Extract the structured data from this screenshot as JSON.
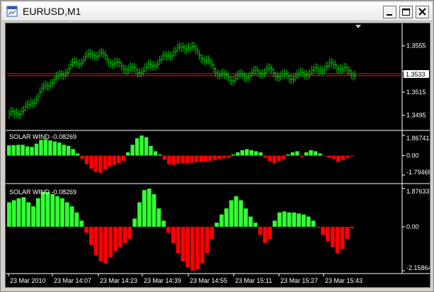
{
  "window": {
    "title": "EURUSD,M1",
    "controls": {
      "minimize": "minimize",
      "maximize": "maximize",
      "close": "close"
    }
  },
  "colors": {
    "background": "#000000",
    "bars": "#00c800",
    "positive": "#33ff33",
    "negative": "#ff0000",
    "axis_text": "#ffffff",
    "price_line": "#d02020"
  },
  "price_chart": {
    "type": "ohlc-bars",
    "y_ticks": [
      "1.3555",
      "1.3533",
      "1.3515",
      "1.3495"
    ],
    "tick_values": [
      1.3555,
      1.3533,
      1.3515,
      1.3495
    ],
    "current_price_label": "1.3533",
    "ylim": [
      1.3485,
      1.3572
    ],
    "closes": [
      1.3496,
      1.3499,
      1.3503,
      1.351,
      1.3518,
      1.3524,
      1.3527,
      1.3533,
      1.3538,
      1.3542,
      1.3545,
      1.3549,
      1.3547,
      1.3543,
      1.3539,
      1.3537,
      1.3535,
      1.3533,
      1.3535,
      1.3538,
      1.3542,
      1.3546,
      1.355,
      1.3553,
      1.3555,
      1.3551,
      1.3545,
      1.3539,
      1.3533,
      1.3528,
      1.3527,
      1.3528,
      1.353,
      1.3531,
      1.3533,
      1.3534,
      1.3531,
      1.3529,
      1.3528,
      1.3529,
      1.3531,
      1.3533,
      1.3534,
      1.3537,
      1.3539,
      1.3536,
      1.3533,
      1.3531
    ]
  },
  "indicators": [
    {
      "name": "SOLAR WIND",
      "label": "SOLAR WIND -0.08269",
      "y_labels": [
        "1.86741",
        "0.00",
        "-1.79468"
      ],
      "ylim": [
        -1.79468,
        1.86741
      ],
      "values": [
        0.95,
        0.97,
        0.99,
        1.0,
        0.85,
        0.8,
        1.1,
        1.45,
        1.5,
        1.4,
        1.3,
        1.2,
        1.0,
        0.9,
        0.6,
        0.2,
        -0.3,
        -0.8,
        -1.2,
        -1.5,
        -1.6,
        -1.3,
        -1.0,
        -0.85,
        -0.7,
        -0.5,
        0.3,
        1.0,
        1.6,
        1.85,
        1.7,
        0.9,
        0.4,
        0.1,
        -0.4,
        -0.8,
        -0.85,
        -0.75,
        -0.7,
        -0.7,
        -0.65,
        -0.6,
        -0.6,
        -0.55,
        -0.5,
        -0.4,
        -0.3,
        -0.25,
        -0.2,
        0.1,
        0.3,
        0.5,
        0.6,
        0.5,
        0.4,
        0.3,
        -0.2,
        -0.5,
        -0.7,
        -0.5,
        -0.3,
        0.1,
        0.3,
        0.4,
        -0.1,
        0.3,
        0.5,
        0.4,
        0.2,
        -0.05,
        -0.2,
        -0.3,
        -0.6,
        -0.4,
        -0.2,
        -0.08
      ]
    },
    {
      "name": "SOLAR WIND",
      "label": "SOLAR WIND -0.08269",
      "y_labels": [
        "1.87633",
        "0.00",
        "-2.15864"
      ],
      "ylim": [
        -2.15864,
        1.87633
      ],
      "values": [
        1.2,
        1.3,
        1.4,
        1.45,
        1.2,
        1.0,
        1.4,
        1.7,
        1.7,
        1.6,
        1.5,
        1.4,
        1.2,
        1.0,
        0.7,
        0.3,
        -0.3,
        -0.9,
        -1.4,
        -1.7,
        -1.8,
        -1.5,
        -1.2,
        -1.0,
        -0.8,
        -0.6,
        0.4,
        1.2,
        1.8,
        1.87,
        1.6,
        0.9,
        0.3,
        -0.3,
        -0.8,
        -1.3,
        -1.7,
        -2.0,
        -2.15,
        -2.1,
        -1.8,
        -1.3,
        -0.6,
        0.2,
        0.6,
        0.9,
        1.3,
        1.5,
        1.3,
        0.9,
        0.5,
        0.2,
        -0.4,
        -0.8,
        -0.6,
        0.3,
        0.7,
        0.75,
        0.7,
        0.7,
        0.65,
        0.6,
        0.5,
        0.3,
        -0.05,
        -0.4,
        -0.7,
        -1.0,
        -1.3,
        -1.1,
        -0.6,
        -0.08
      ]
    }
  ],
  "x_axis": {
    "labels": [
      "23 Mar 2010",
      "23 Mar 14:07",
      "23 Mar 14:23",
      "23 Mar 14:39",
      "23 Mar 14:55",
      "23 Mar 15:11",
      "23 Mar 15:27",
      "23 Mar 15:43"
    ]
  }
}
